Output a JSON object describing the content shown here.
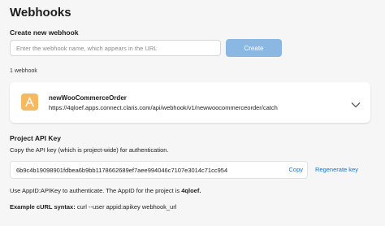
{
  "page": {
    "title": "Webhooks"
  },
  "create": {
    "label": "Create new webhook",
    "input_placeholder": "Enter the webhook name, which appears in the URL",
    "button_label": "Create"
  },
  "webhooks": {
    "count_label": "1 webhook",
    "items": [
      {
        "name": "newWooCommerceOrder",
        "url": "https://4qloef.apps.connect.claris.com/api/webhook/v1/newwoocommerceorder/catch",
        "icon": "woocommerce-app-icon"
      }
    ]
  },
  "api_key": {
    "title": "Project API Key",
    "description": "Copy the API key (which is project-wide) for authentication.",
    "value": "6b9c4b19098901fdbea6b9bb1178662689ef7aee994046c7107e3014c71cc954",
    "copy_label": "Copy",
    "regenerate_label": "Regenerate key",
    "auth_note_prefix": "Use AppID:APIKey to authenticate. The AppID for the project is",
    "app_id": "4qloef.",
    "curl_label": "Example cURL syntax:",
    "curl_value": "curl --user appid:apikey webhook_url"
  },
  "colors": {
    "accent": "#1f73c9",
    "button_disabled": "#8bb8e2",
    "app_icon": "#f7b95f",
    "background": "#f6f6f7"
  }
}
